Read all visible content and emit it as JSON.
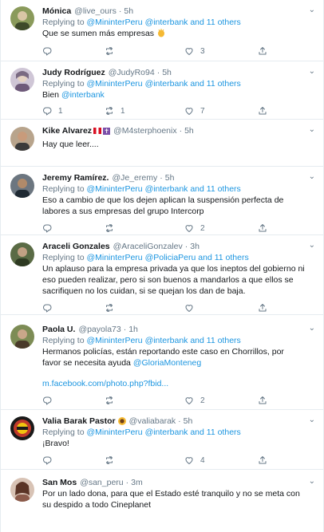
{
  "tweets": [
    {
      "name": "Mónica",
      "handle": "@live_ours",
      "time": "5h",
      "reply_prefix": "Replying to",
      "reply_mention1": "@MininterPeru",
      "reply_mention2": "@interbank",
      "reply_rest": "and 11 others",
      "text": "Que se sumen más empresas",
      "emoji": "clapping-hands-emoji",
      "replies": "",
      "retweets": "",
      "likes": "3",
      "avatar_color": "#8a9a5b"
    },
    {
      "name": "Judy Rodríguez",
      "handle": "@JudyRo94",
      "time": "5h",
      "reply_prefix": "Replying to",
      "reply_mention1": "@MininterPeru",
      "reply_mention2": "@interbank",
      "reply_rest": "and 11 others",
      "text": "Bien",
      "text_link": "@interbank",
      "replies": "1",
      "retweets": "1",
      "likes": "7",
      "avatar_color": "#9b8fa3"
    },
    {
      "name": "Kike Alvarez",
      "handle": "@M4sterphoenix",
      "time": "5h",
      "text": "Hay que leer....",
      "replies": "",
      "retweets": "",
      "likes": "",
      "avatar_color": "#7a6a5a"
    },
    {
      "name": "Jeremy Ramírez.",
      "handle": "@Je_eremy",
      "time": "5h",
      "reply_prefix": "Replying to",
      "reply_mention1": "@MininterPeru",
      "reply_mention2": "@interbank",
      "reply_rest": "and 11 others",
      "text_lines": [
        "Eso a cambio de que los dejen aplican la suspensión perfecta de",
        "labores a sus empresas del grupo Intercorp"
      ],
      "replies": "",
      "retweets": "",
      "likes": "2",
      "avatar_color": "#4a5560"
    },
    {
      "name": "Araceli Gonzales",
      "handle": "@AraceliGonzalev",
      "time": "3h",
      "reply_prefix": "Replying to",
      "reply_mention1": "@MininterPeru",
      "reply_mention2": "@PoliciaPeru",
      "reply_rest": "and 11 others",
      "text_lines": [
        "Un aplauso para la empresa privada ya que los ineptos del gobierno ni",
        "eso pueden realizar, pero si son buenos a mandarlos a que ellos se",
        "sacrifiquen no los cuidan, si se quejan los dan de baja."
      ],
      "replies": "",
      "retweets": "",
      "likes": "",
      "avatar_color": "#5a6b45"
    },
    {
      "name": "Paola U.",
      "handle": "@payola73",
      "time": "1h",
      "reply_prefix": "Replying to",
      "reply_mention1": "@MininterPeru",
      "reply_mention2": "@interbank",
      "reply_rest": "and 11 others",
      "text_lines": [
        "Hermanos policías, están reportando este caso en Chorrillos,  por",
        "favor se necesita ayuda"
      ],
      "text_link": "@GloriaMonteneg",
      "url": "m.facebook.com/photo.php?fbid...",
      "replies": "",
      "retweets": "",
      "likes": "2",
      "avatar_color": "#6b7a4a"
    },
    {
      "name": "Valia Barak Pastor",
      "handle": "@valiabarak",
      "time": "5h",
      "reply_prefix": "Replying to",
      "reply_mention1": "@MininterPeru",
      "reply_mention2": "@interbank",
      "reply_rest": "and 11 others",
      "text": "¡Bravo!",
      "replies": "",
      "retweets": "",
      "likes": "4",
      "avatar_color": "#c0392b"
    },
    {
      "name": "San Mos",
      "handle": "@san_peru",
      "time": "3m",
      "text_lines": [
        "Por un lado dona, para que el Estado esté tranquilo y no se meta con",
        "su despido a todo Cineplanet"
      ],
      "avatar_color": "#8b5a4a"
    }
  ],
  "colors": {
    "link": "#1b95e0",
    "muted": "#657786",
    "border": "#e6ecf0"
  },
  "icons": {
    "reply": "reply-icon",
    "retweet": "retweet-icon",
    "like": "heart-icon",
    "share": "share-icon",
    "caret": "chevron-down-icon"
  }
}
